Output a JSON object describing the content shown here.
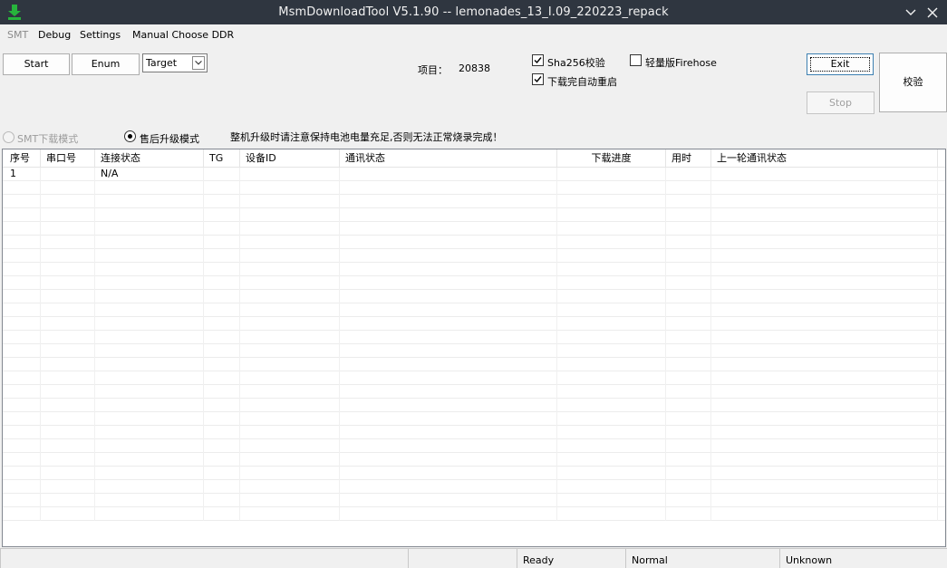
{
  "window": {
    "title": "MsmDownloadTool V5.1.90 -- lemonades_13_I.09_220223_repack",
    "icon": "green-download-arrow-icon",
    "accent": "#27b43c",
    "titlebar_color": "#2f3640"
  },
  "menu": {
    "items": [
      "SMT",
      "Debug",
      "Settings",
      "Manual Choose DDR"
    ]
  },
  "toolbar": {
    "start_label": "Start",
    "enum_label": "Enum",
    "target_value": "Target",
    "project_label": "项目：",
    "project_value": "20838",
    "sha256_label": "Sha256校验",
    "sha256_checked": true,
    "lite_firehose_label": "轻量版Firehose",
    "lite_firehose_checked": false,
    "auto_reboot_label": "下载完自动重启",
    "auto_reboot_checked": true,
    "exit_label": "Exit",
    "stop_label": "Stop",
    "verify_label": "校验"
  },
  "mode": {
    "smt_label": "SMT下载模式",
    "smt_selected": false,
    "aftersale_label": "售后升级模式",
    "aftersale_selected": true,
    "warning": "整机升级时请注意保持电池电量充足,否则无法正常烧录完成！"
  },
  "table": {
    "columns": [
      "序号",
      "串口号",
      "连接状态",
      "TG",
      "设备ID",
      "通讯状态",
      "下载进度",
      "用时",
      "上一轮通讯状态"
    ],
    "rows": [
      [
        "1",
        "",
        "N/A",
        "",
        "",
        "",
        "",
        "",
        ""
      ]
    ]
  },
  "statusbar": {
    "panes": [
      "",
      "",
      "Ready",
      "Normal",
      "Unknown"
    ]
  }
}
